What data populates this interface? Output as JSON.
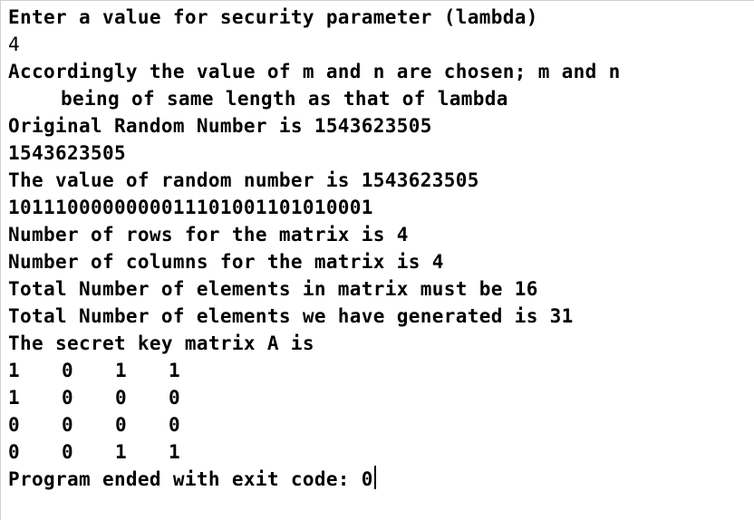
{
  "console": {
    "lines": {
      "prompt": "Enter a value for security parameter (lambda)",
      "input_value": "4",
      "choice_note_1": "Accordingly the value of m and n are chosen; m and n",
      "choice_note_2": "being of same length as that of lambda",
      "original_random": "Original Random Number is 1543623505",
      "random_echo": "1543623505",
      "random_value": "The value of random number is 1543623505",
      "binary": "1011100000000011101001101010001",
      "rows": "Number of rows for the matrix is 4",
      "columns": "Number of columns for the matrix is 4",
      "total_required": "Total Number of elements in matrix must be 16",
      "total_generated": "Total Number of elements we have generated is 31",
      "matrix_heading": "The secret key matrix A is",
      "exit_message": "Program ended with exit code: 0"
    },
    "matrix": [
      [
        "1",
        "0",
        "1",
        "1"
      ],
      [
        "1",
        "0",
        "0",
        "0"
      ],
      [
        "0",
        "0",
        "0",
        "0"
      ],
      [
        "0",
        "0",
        "1",
        "1"
      ]
    ]
  }
}
